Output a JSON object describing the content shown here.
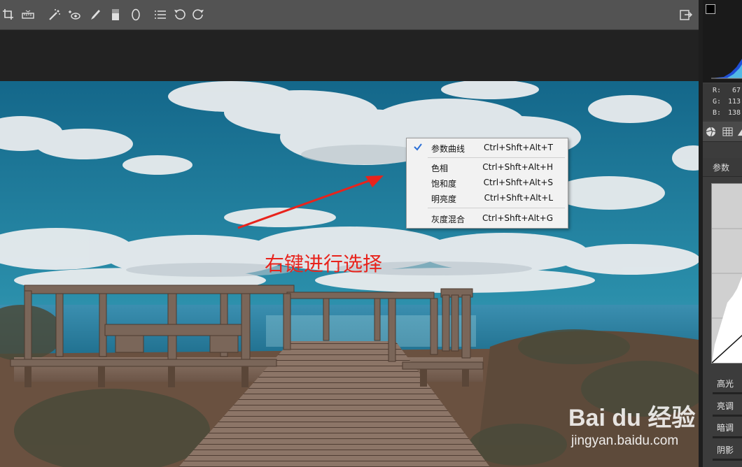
{
  "toolbar": {
    "tools": [
      "crop-icon",
      "straighten-icon",
      "spot-removal-icon",
      "red-eye-icon",
      "brush-icon",
      "graduated-filter-icon",
      "radial-filter-icon",
      "list-icon",
      "rotate-left-icon",
      "rotate-right-icon"
    ],
    "right_tool": "export-icon"
  },
  "context_menu": {
    "items": [
      {
        "label": "参数曲线",
        "shortcut": "Ctrl+Shft+Alt+T",
        "checked": true
      },
      {
        "label": "色相",
        "shortcut": "Ctrl+Shft+Alt+H"
      },
      {
        "label": "饱和度",
        "shortcut": "Ctrl+Shft+Alt+S"
      },
      {
        "label": "明亮度",
        "shortcut": "Ctrl+Shft+Alt+L"
      },
      {
        "label": "灰度混合",
        "shortcut": "Ctrl+Shft+Alt+G"
      }
    ]
  },
  "annotation": {
    "text": "右键进行选择",
    "color": "#e8231c"
  },
  "panel": {
    "rgb": [
      {
        "channel": "R:",
        "value": "67"
      },
      {
        "channel": "G:",
        "value": "113"
      },
      {
        "channel": "B:",
        "value": "138"
      }
    ],
    "tab_label": "参数",
    "sliders": [
      "高光",
      "亮调",
      "暗调",
      "阴影"
    ]
  },
  "watermark": {
    "logo": "Bai du 经验",
    "url": "jingyan.baidu.com"
  },
  "colors": {
    "toolbar": "#535353",
    "sky": "#1f7f9c",
    "menu_bg": "#f2f2f2",
    "check": "#2a6fd6"
  }
}
